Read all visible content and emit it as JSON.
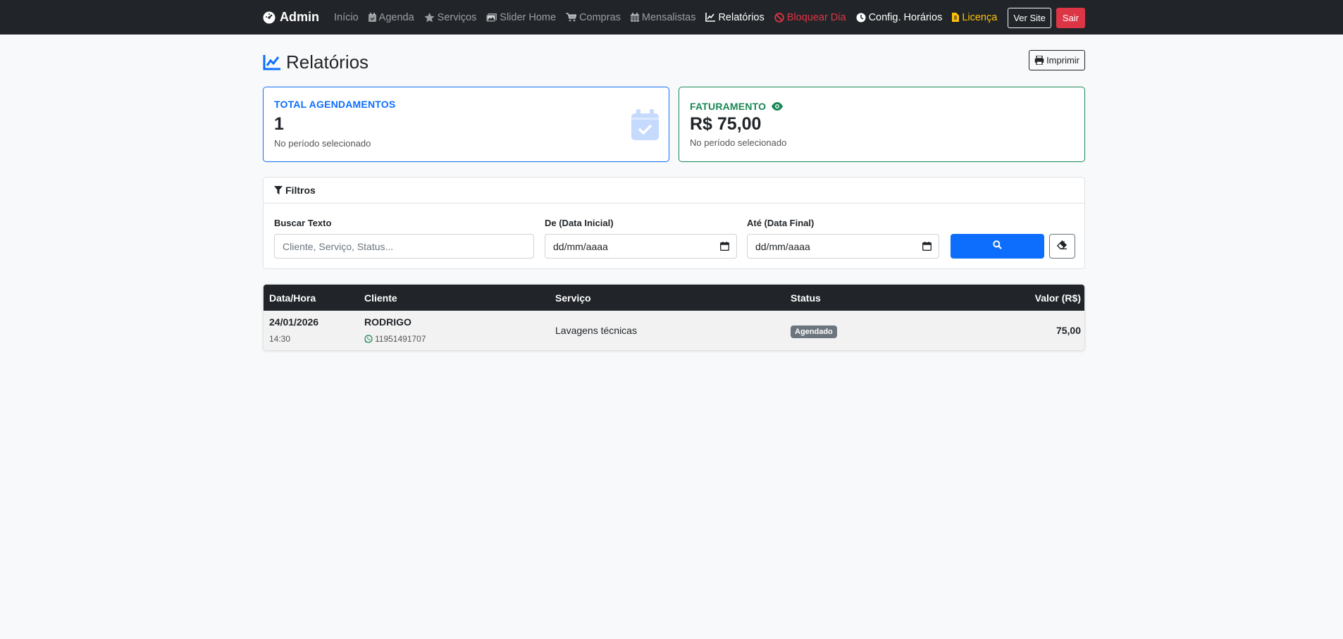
{
  "nav": {
    "brand": "Admin",
    "items": [
      {
        "label": "Início",
        "icon": "none"
      },
      {
        "label": "Agenda",
        "icon": "calendar-icon"
      },
      {
        "label": "Serviços",
        "icon": "star-icon"
      },
      {
        "label": "Slider Home",
        "icon": "images-icon"
      },
      {
        "label": "Compras",
        "icon": "cart-icon"
      },
      {
        "label": "Mensalistas",
        "icon": "calendar-grid-icon"
      },
      {
        "label": "Relatórios",
        "icon": "chart-line-icon"
      },
      {
        "label": "Bloquear Dia",
        "icon": "ban-icon"
      },
      {
        "label": "Config. Horários",
        "icon": "clock-icon"
      },
      {
        "label": "Licença",
        "icon": "file-icon"
      }
    ],
    "ver_site": "Ver Site",
    "sair": "Sair"
  },
  "page": {
    "title": "Relatórios",
    "print_label": "Imprimir"
  },
  "stats": {
    "total": {
      "label": "TOTAL AGENDAMENTOS",
      "value": "1",
      "sub": "No período selecionado"
    },
    "faturamento": {
      "label": "FATURAMENTO",
      "value": "R$ 75,00",
      "sub": "No período selecionado"
    }
  },
  "filters": {
    "title": "Filtros",
    "text_label": "Buscar Texto",
    "text_placeholder": "Cliente, Serviço, Status...",
    "from_label": "De (Data Inicial)",
    "from_value": "dd/mm/aaaa",
    "to_label": "Até (Data Final)",
    "to_value": "dd/mm/aaaa"
  },
  "table": {
    "headers": {
      "datetime": "Data/Hora",
      "client": "Cliente",
      "service": "Serviço",
      "status": "Status",
      "value": "Valor (R$)"
    },
    "rows": [
      {
        "date": "24/01/2026",
        "time": "14:30",
        "client": "RODRIGO",
        "phone": "11951491707",
        "service": "Lavagens técnicas",
        "status": "Agendado",
        "value": "75,00"
      }
    ]
  },
  "colors": {
    "primary": "#0d6efd",
    "success": "#198754",
    "danger": "#dc3545",
    "warning": "#ffc107",
    "dark": "#212529"
  }
}
